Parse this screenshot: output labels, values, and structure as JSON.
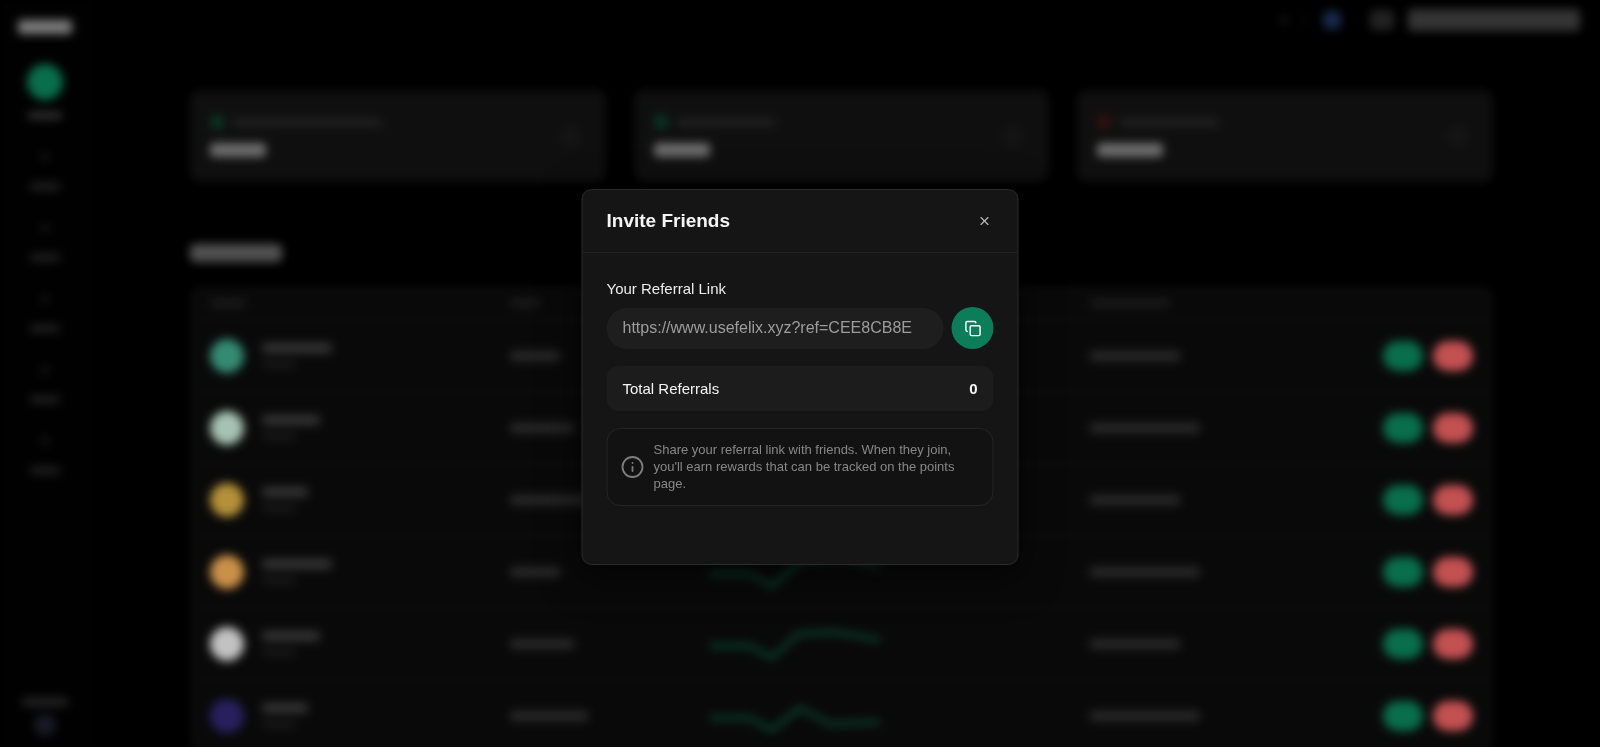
{
  "dialog": {
    "title": "Invite Friends"
  },
  "referral_link": {
    "label": "Your Referral Link",
    "value": "https://www.usefelix.xyz?ref=CEE8CB8E"
  },
  "total_referrals": {
    "label": "Total Referrals",
    "value": "0"
  },
  "info_note": {
    "text": "Share your referral link with friends. When they join, you'll earn rewards that can be tracked on the points page."
  }
}
